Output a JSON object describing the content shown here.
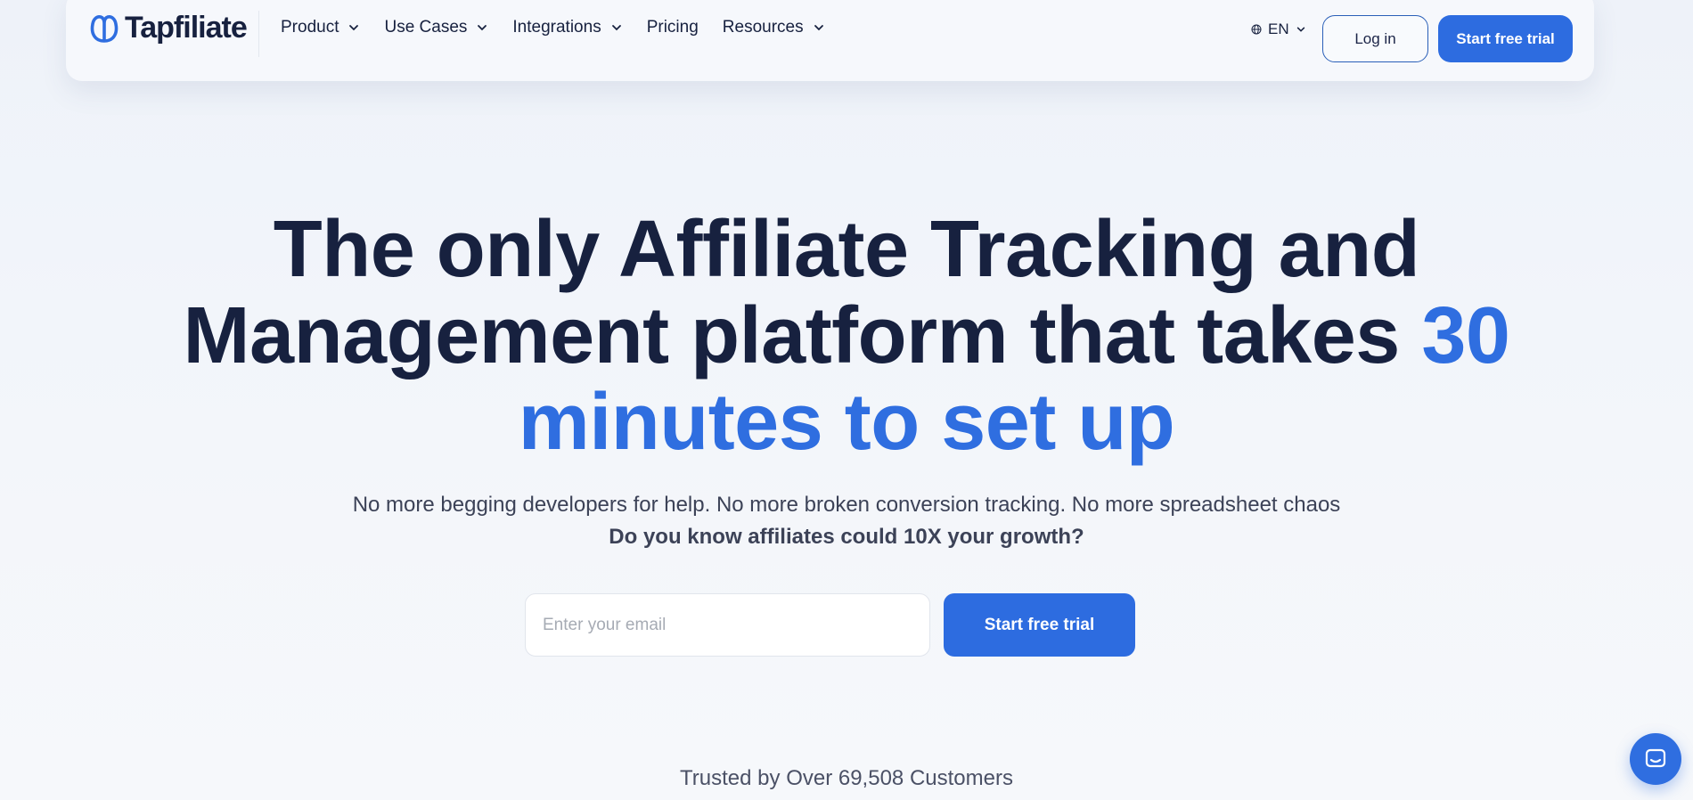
{
  "brand": {
    "name": "Tapfiliate",
    "accent_color": "#2d6ce0",
    "dark_color": "#17213f"
  },
  "nav": {
    "items": [
      {
        "label": "Product",
        "has_dropdown": true
      },
      {
        "label": "Use Cases",
        "has_dropdown": true
      },
      {
        "label": "Integrations",
        "has_dropdown": true
      },
      {
        "label": "Pricing",
        "has_dropdown": false
      },
      {
        "label": "Resources",
        "has_dropdown": true
      }
    ],
    "language": "EN",
    "login_label": "Log in",
    "trial_label": "Start free trial"
  },
  "hero": {
    "title_main": "The only Affiliate Tracking and Management platform that takes ",
    "title_accent": "30 minutes to set up",
    "subtitle": "No more begging developers for help. No more broken conversion tracking. No more spreadsheet chaos",
    "subtitle_bold": "Do you know affiliates could 10X your growth?",
    "email_placeholder": "Enter your email",
    "cta_label": "Start free trial"
  },
  "trusted": "Trusted by Over 69,508 Customers",
  "icons": {
    "logo": "tapfiliate-logo-icon",
    "globe": "globe-icon",
    "chevron": "chevron-down-icon",
    "chat": "chat-icon"
  }
}
